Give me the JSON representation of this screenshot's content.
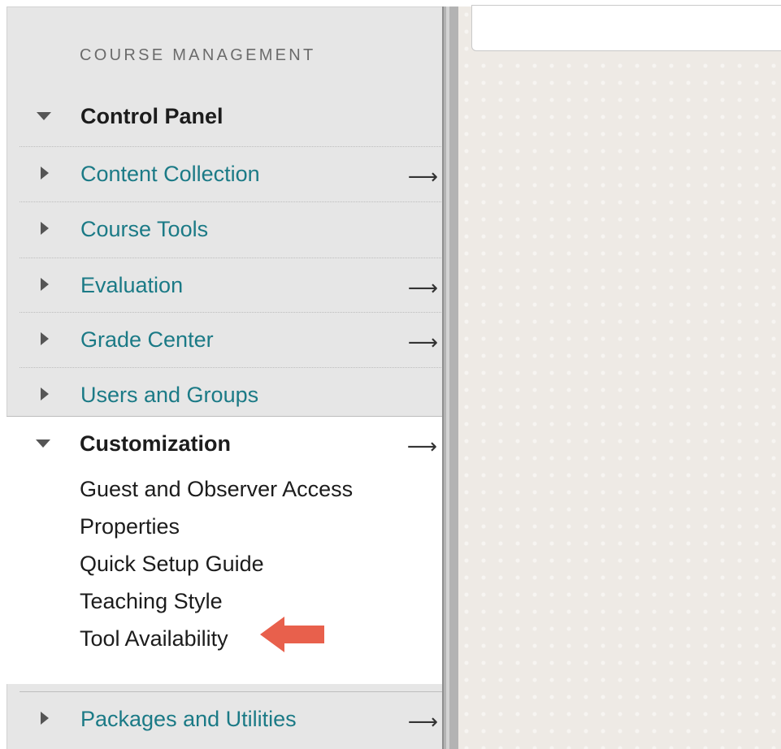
{
  "sidebar": {
    "heading": "COURSE MANAGEMENT",
    "control_panel": "Control Panel",
    "items": [
      {
        "label": "Content Collection",
        "arrow": "⟶"
      },
      {
        "label": "Course Tools",
        "arrow": ""
      },
      {
        "label": "Evaluation",
        "arrow": "⟶"
      },
      {
        "label": "Grade Center",
        "arrow": "⟶"
      },
      {
        "label": "Users and Groups",
        "arrow": ""
      }
    ],
    "customization": {
      "label": "Customization",
      "arrow": "⟶",
      "sub_items": [
        "Guest and Observer Access",
        "Properties",
        "Quick Setup Guide",
        "Teaching Style",
        "Tool Availability"
      ]
    },
    "packages": {
      "label": "Packages and Utilities",
      "arrow": "⟶"
    }
  },
  "colors": {
    "link": "#1b7a86",
    "pointer_arrow": "#e8604c",
    "sidebar_bg": "#e6e6e6",
    "main_bg": "#eeeae5"
  },
  "icons": {
    "collapsed": "caret-right-icon",
    "expanded": "caret-down-icon",
    "go": "arrow-right-icon",
    "pointer": "red-pointer-arrow-icon"
  }
}
